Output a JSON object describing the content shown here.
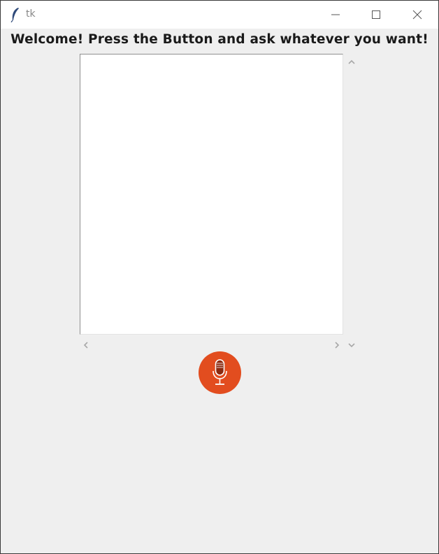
{
  "window": {
    "title": "tk",
    "controls": {
      "minimize_icon": "minimize-icon",
      "maximize_icon": "maximize-icon",
      "close_icon": "close-icon"
    }
  },
  "main": {
    "heading": "Welcome! Press the Button and ask whatever you want!",
    "text_area": {
      "value": ""
    },
    "mic_button": {
      "icon": "microphone-icon",
      "color": "#e24d1f"
    }
  },
  "colors": {
    "window_background": "#efefef",
    "titlebar_background": "#ffffff",
    "text_area_background": "#ffffff"
  }
}
